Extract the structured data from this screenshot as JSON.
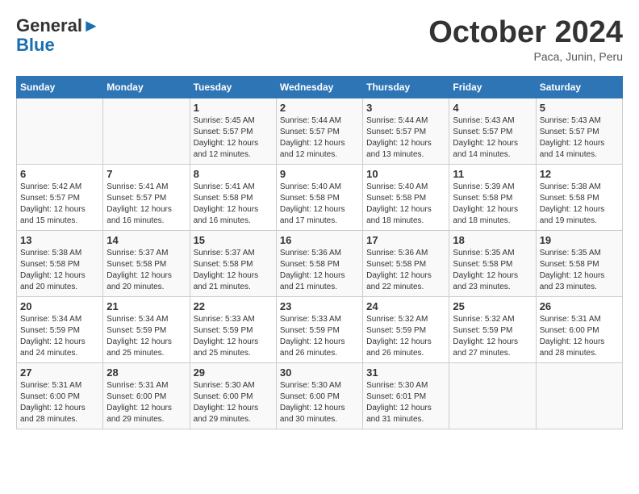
{
  "header": {
    "logo_general": "General",
    "logo_blue": "Blue",
    "month_title": "October 2024",
    "subtitle": "Paca, Junin, Peru"
  },
  "days_of_week": [
    "Sunday",
    "Monday",
    "Tuesday",
    "Wednesday",
    "Thursday",
    "Friday",
    "Saturday"
  ],
  "weeks": [
    [
      {
        "day": "",
        "sunrise": "",
        "sunset": "",
        "daylight": ""
      },
      {
        "day": "",
        "sunrise": "",
        "sunset": "",
        "daylight": ""
      },
      {
        "day": "1",
        "sunrise": "Sunrise: 5:45 AM",
        "sunset": "Sunset: 5:57 PM",
        "daylight": "Daylight: 12 hours and 12 minutes."
      },
      {
        "day": "2",
        "sunrise": "Sunrise: 5:44 AM",
        "sunset": "Sunset: 5:57 PM",
        "daylight": "Daylight: 12 hours and 12 minutes."
      },
      {
        "day": "3",
        "sunrise": "Sunrise: 5:44 AM",
        "sunset": "Sunset: 5:57 PM",
        "daylight": "Daylight: 12 hours and 13 minutes."
      },
      {
        "day": "4",
        "sunrise": "Sunrise: 5:43 AM",
        "sunset": "Sunset: 5:57 PM",
        "daylight": "Daylight: 12 hours and 14 minutes."
      },
      {
        "day": "5",
        "sunrise": "Sunrise: 5:43 AM",
        "sunset": "Sunset: 5:57 PM",
        "daylight": "Daylight: 12 hours and 14 minutes."
      }
    ],
    [
      {
        "day": "6",
        "sunrise": "Sunrise: 5:42 AM",
        "sunset": "Sunset: 5:57 PM",
        "daylight": "Daylight: 12 hours and 15 minutes."
      },
      {
        "day": "7",
        "sunrise": "Sunrise: 5:41 AM",
        "sunset": "Sunset: 5:57 PM",
        "daylight": "Daylight: 12 hours and 16 minutes."
      },
      {
        "day": "8",
        "sunrise": "Sunrise: 5:41 AM",
        "sunset": "Sunset: 5:58 PM",
        "daylight": "Daylight: 12 hours and 16 minutes."
      },
      {
        "day": "9",
        "sunrise": "Sunrise: 5:40 AM",
        "sunset": "Sunset: 5:58 PM",
        "daylight": "Daylight: 12 hours and 17 minutes."
      },
      {
        "day": "10",
        "sunrise": "Sunrise: 5:40 AM",
        "sunset": "Sunset: 5:58 PM",
        "daylight": "Daylight: 12 hours and 18 minutes."
      },
      {
        "day": "11",
        "sunrise": "Sunrise: 5:39 AM",
        "sunset": "Sunset: 5:58 PM",
        "daylight": "Daylight: 12 hours and 18 minutes."
      },
      {
        "day": "12",
        "sunrise": "Sunrise: 5:38 AM",
        "sunset": "Sunset: 5:58 PM",
        "daylight": "Daylight: 12 hours and 19 minutes."
      }
    ],
    [
      {
        "day": "13",
        "sunrise": "Sunrise: 5:38 AM",
        "sunset": "Sunset: 5:58 PM",
        "daylight": "Daylight: 12 hours and 20 minutes."
      },
      {
        "day": "14",
        "sunrise": "Sunrise: 5:37 AM",
        "sunset": "Sunset: 5:58 PM",
        "daylight": "Daylight: 12 hours and 20 minutes."
      },
      {
        "day": "15",
        "sunrise": "Sunrise: 5:37 AM",
        "sunset": "Sunset: 5:58 PM",
        "daylight": "Daylight: 12 hours and 21 minutes."
      },
      {
        "day": "16",
        "sunrise": "Sunrise: 5:36 AM",
        "sunset": "Sunset: 5:58 PM",
        "daylight": "Daylight: 12 hours and 21 minutes."
      },
      {
        "day": "17",
        "sunrise": "Sunrise: 5:36 AM",
        "sunset": "Sunset: 5:58 PM",
        "daylight": "Daylight: 12 hours and 22 minutes."
      },
      {
        "day": "18",
        "sunrise": "Sunrise: 5:35 AM",
        "sunset": "Sunset: 5:58 PM",
        "daylight": "Daylight: 12 hours and 23 minutes."
      },
      {
        "day": "19",
        "sunrise": "Sunrise: 5:35 AM",
        "sunset": "Sunset: 5:58 PM",
        "daylight": "Daylight: 12 hours and 23 minutes."
      }
    ],
    [
      {
        "day": "20",
        "sunrise": "Sunrise: 5:34 AM",
        "sunset": "Sunset: 5:59 PM",
        "daylight": "Daylight: 12 hours and 24 minutes."
      },
      {
        "day": "21",
        "sunrise": "Sunrise: 5:34 AM",
        "sunset": "Sunset: 5:59 PM",
        "daylight": "Daylight: 12 hours and 25 minutes."
      },
      {
        "day": "22",
        "sunrise": "Sunrise: 5:33 AM",
        "sunset": "Sunset: 5:59 PM",
        "daylight": "Daylight: 12 hours and 25 minutes."
      },
      {
        "day": "23",
        "sunrise": "Sunrise: 5:33 AM",
        "sunset": "Sunset: 5:59 PM",
        "daylight": "Daylight: 12 hours and 26 minutes."
      },
      {
        "day": "24",
        "sunrise": "Sunrise: 5:32 AM",
        "sunset": "Sunset: 5:59 PM",
        "daylight": "Daylight: 12 hours and 26 minutes."
      },
      {
        "day": "25",
        "sunrise": "Sunrise: 5:32 AM",
        "sunset": "Sunset: 5:59 PM",
        "daylight": "Daylight: 12 hours and 27 minutes."
      },
      {
        "day": "26",
        "sunrise": "Sunrise: 5:31 AM",
        "sunset": "Sunset: 6:00 PM",
        "daylight": "Daylight: 12 hours and 28 minutes."
      }
    ],
    [
      {
        "day": "27",
        "sunrise": "Sunrise: 5:31 AM",
        "sunset": "Sunset: 6:00 PM",
        "daylight": "Daylight: 12 hours and 28 minutes."
      },
      {
        "day": "28",
        "sunrise": "Sunrise: 5:31 AM",
        "sunset": "Sunset: 6:00 PM",
        "daylight": "Daylight: 12 hours and 29 minutes."
      },
      {
        "day": "29",
        "sunrise": "Sunrise: 5:30 AM",
        "sunset": "Sunset: 6:00 PM",
        "daylight": "Daylight: 12 hours and 29 minutes."
      },
      {
        "day": "30",
        "sunrise": "Sunrise: 5:30 AM",
        "sunset": "Sunset: 6:00 PM",
        "daylight": "Daylight: 12 hours and 30 minutes."
      },
      {
        "day": "31",
        "sunrise": "Sunrise: 5:30 AM",
        "sunset": "Sunset: 6:01 PM",
        "daylight": "Daylight: 12 hours and 31 minutes."
      },
      {
        "day": "",
        "sunrise": "",
        "sunset": "",
        "daylight": ""
      },
      {
        "day": "",
        "sunrise": "",
        "sunset": "",
        "daylight": ""
      }
    ]
  ]
}
